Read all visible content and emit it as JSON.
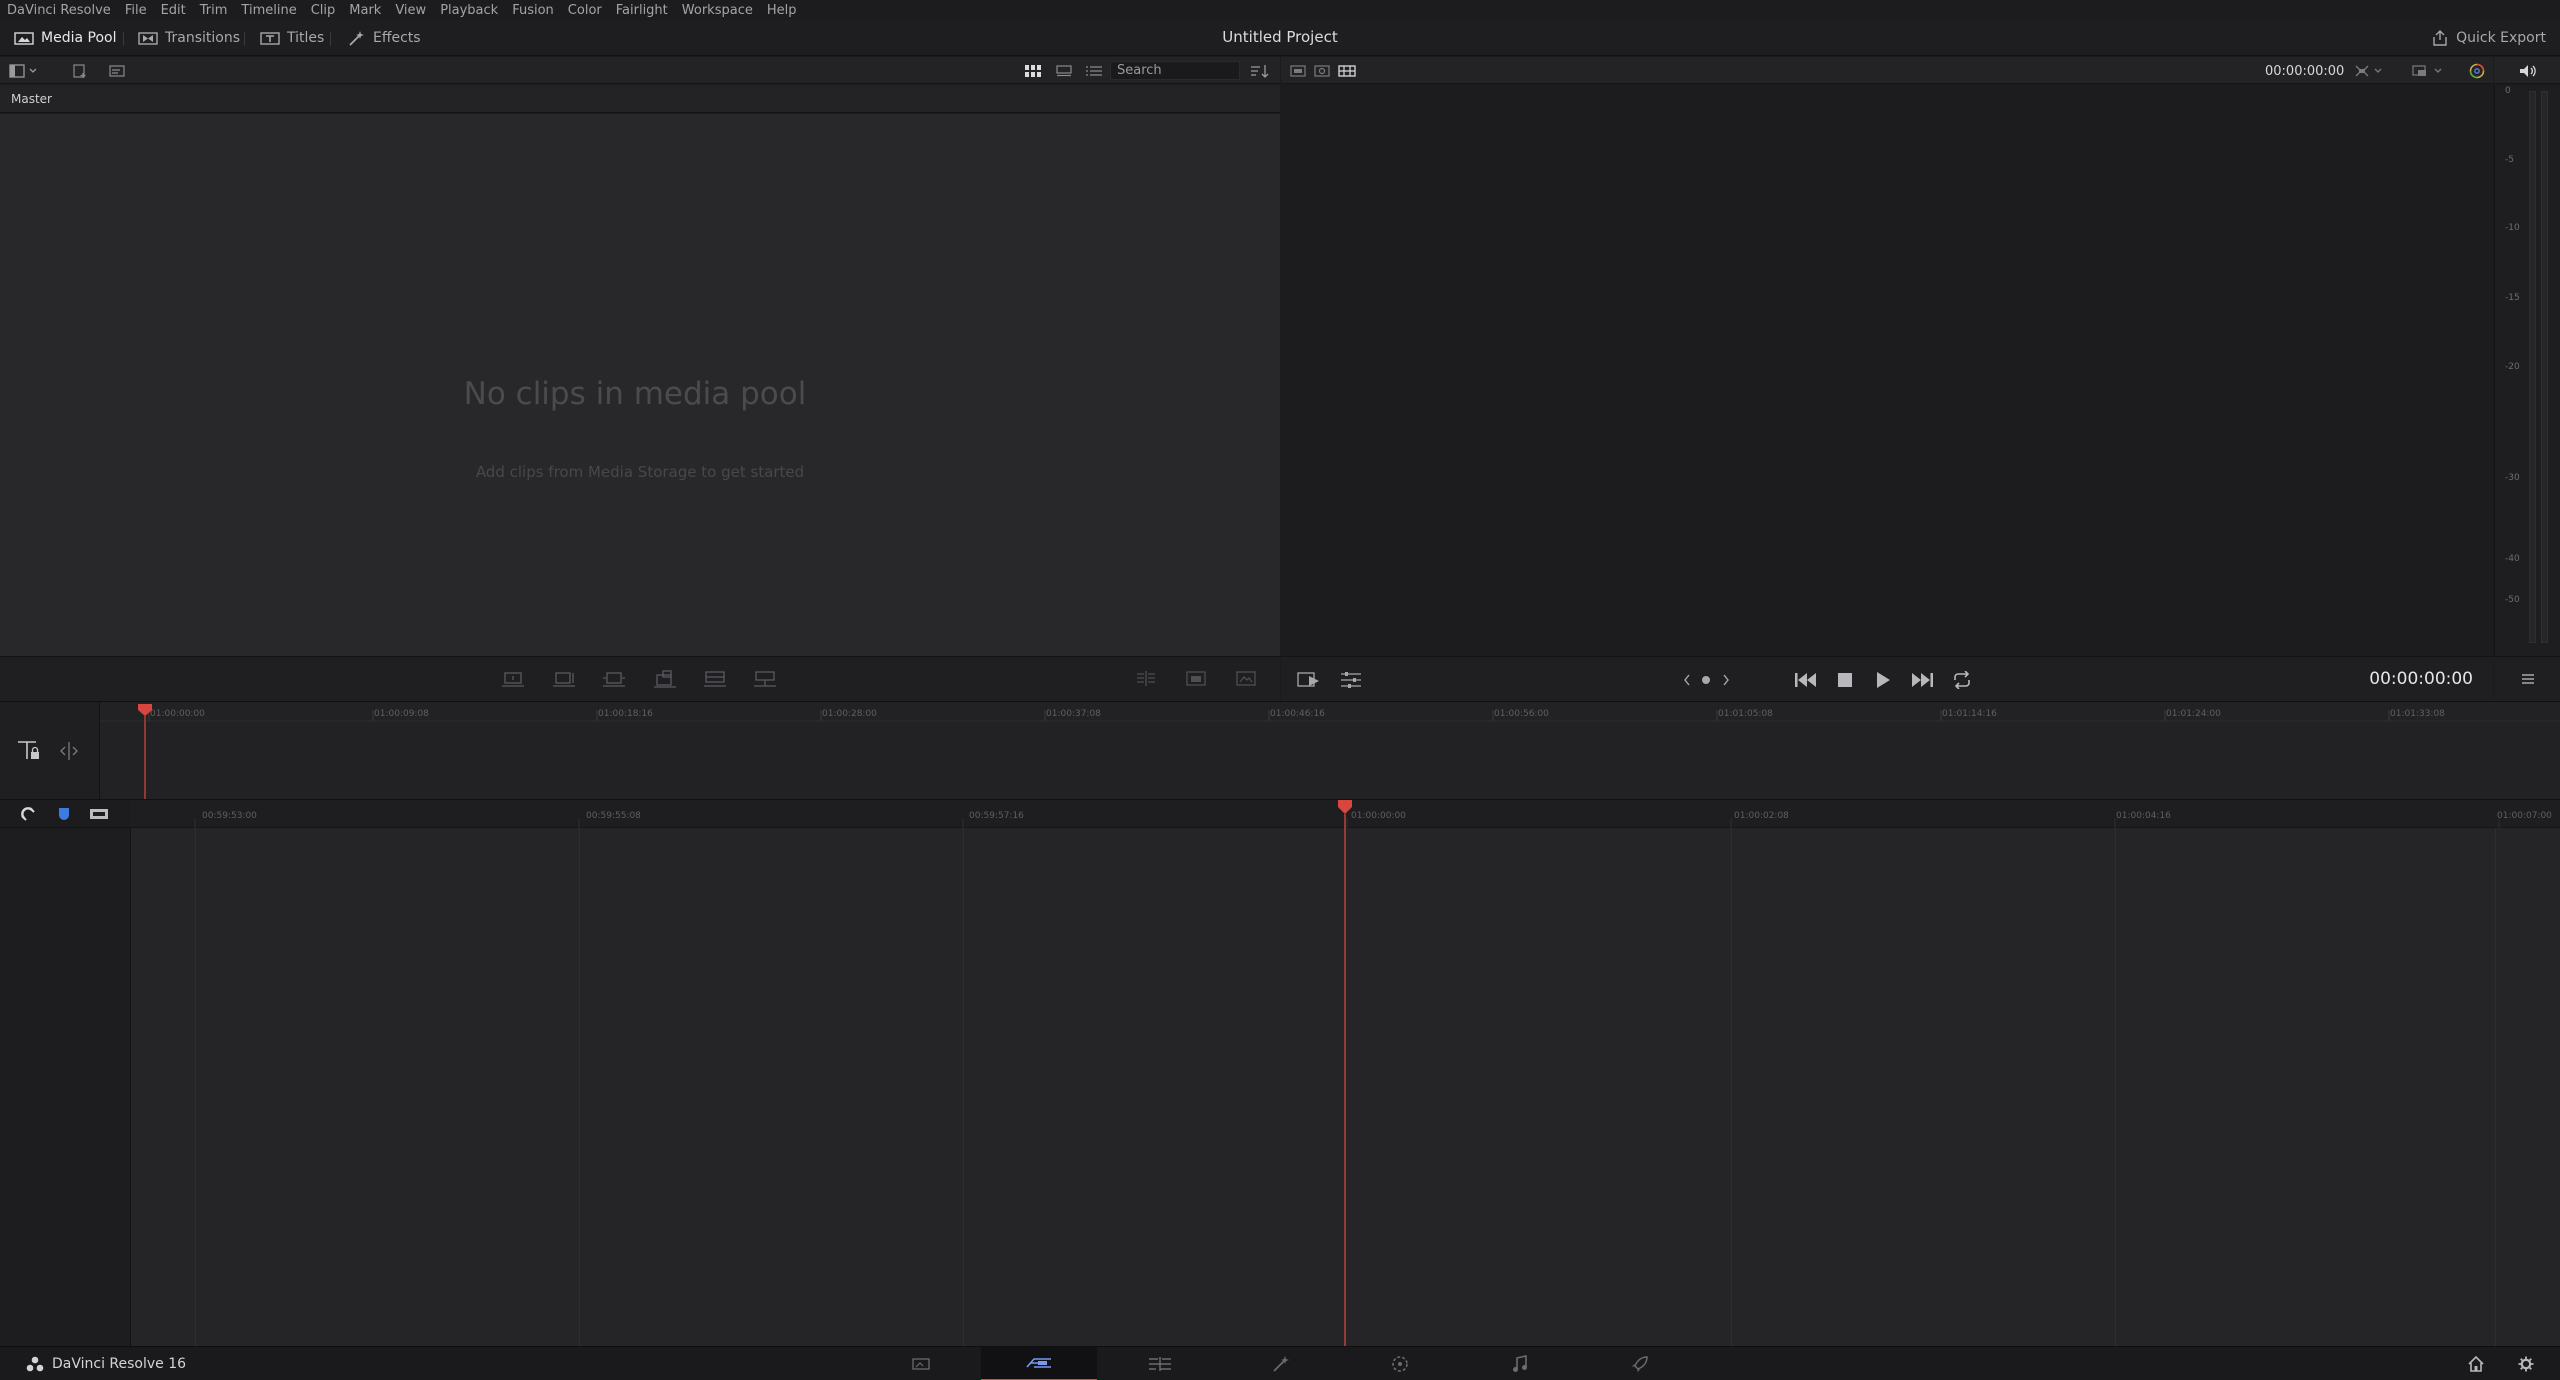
{
  "colors": {
    "accent": "#d8473f",
    "active_page": "#5e7bd9",
    "background": "#1b1b1d"
  },
  "menu": [
    "DaVinci Resolve",
    "File",
    "Edit",
    "Trim",
    "Timeline",
    "Clip",
    "Mark",
    "View",
    "Playback",
    "Fusion",
    "Color",
    "Fairlight",
    "Workspace",
    "Help"
  ],
  "toolbar": {
    "media_pool": "Media Pool",
    "transitions": "Transitions",
    "titles": "Titles",
    "effects": "Effects",
    "project_title": "Untitled Project",
    "quick_export": "Quick Export"
  },
  "media_pool": {
    "search_placeholder": "Search",
    "bin": "Master",
    "empty_title": "No clips in media pool",
    "empty_subtitle": "Add clips from Media Storage to get started"
  },
  "viewer": {
    "timecode": "00:00:00:00",
    "transport_timecode": "00:00:00:00"
  },
  "meters": {
    "scale": [
      "0",
      "-5",
      "-10",
      "-15",
      "-20",
      "-30",
      "-40",
      "-50"
    ]
  },
  "upper_ruler": [
    "01:00:00:00",
    "01:00:09:08",
    "01:00:18:16",
    "01:00:28:00",
    "01:00:37:08",
    "01:00:46:16",
    "01:00:56:00",
    "01:01:05:08",
    "01:01:14:16",
    "01:01:24:00",
    "01:01:33:08"
  ],
  "lower_ruler": [
    "00:59:53:00",
    "00:59:55:08",
    "00:59:57:16",
    "01:00:00:00",
    "01:00:02:08",
    "01:00:04:16",
    "01:00:07:00"
  ],
  "pagebar": {
    "app_name": "DaVinci Resolve 16"
  }
}
